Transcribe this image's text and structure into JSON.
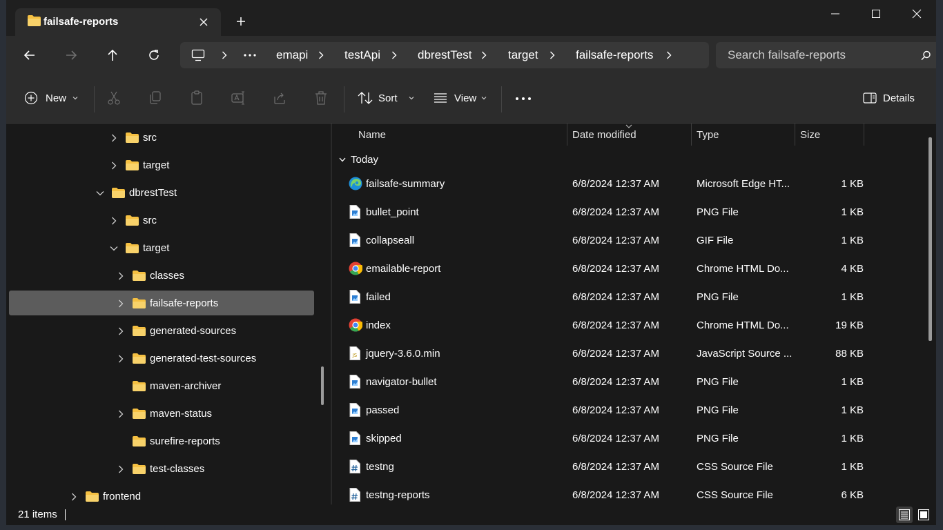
{
  "window": {
    "tab_title": "failsafe-reports"
  },
  "address": {
    "crumbs": [
      "emapi",
      "testApi",
      "dbrestTest",
      "target",
      "failsafe-reports"
    ]
  },
  "search": {
    "placeholder": "Search failsafe-reports"
  },
  "commands": {
    "new_label": "New",
    "sort_label": "Sort",
    "view_label": "View",
    "details_label": "Details"
  },
  "tree": [
    {
      "label": "src",
      "chevron": "right"
    },
    {
      "label": "target",
      "chevron": "right"
    },
    {
      "label": "dbrestTest",
      "chevron": "down"
    },
    {
      "label": "src",
      "chevron": "right"
    },
    {
      "label": "target",
      "chevron": "down"
    },
    {
      "label": "classes",
      "chevron": "right"
    },
    {
      "label": "failsafe-reports",
      "chevron": "right",
      "selected": true
    },
    {
      "label": "generated-sources",
      "chevron": "right"
    },
    {
      "label": "generated-test-sources",
      "chevron": "right"
    },
    {
      "label": "maven-archiver",
      "chevron": "none"
    },
    {
      "label": "maven-status",
      "chevron": "right"
    },
    {
      "label": "surefire-reports",
      "chevron": "none"
    },
    {
      "label": "test-classes",
      "chevron": "right"
    },
    {
      "label": "frontend",
      "chevron": "right"
    }
  ],
  "columns": {
    "name": "Name",
    "date": "Date modified",
    "type": "Type",
    "size": "Size"
  },
  "group": {
    "label": "Today"
  },
  "files": [
    {
      "name": "failsafe-summary",
      "date": "6/8/2024 12:37 AM",
      "type": "Microsoft Edge HT...",
      "size": "1 KB",
      "icon": "edge-icon"
    },
    {
      "name": "bullet_point",
      "date": "6/8/2024 12:37 AM",
      "type": "PNG File",
      "size": "1 KB",
      "icon": "image-file-icon"
    },
    {
      "name": "collapseall",
      "date": "6/8/2024 12:37 AM",
      "type": "GIF File",
      "size": "1 KB",
      "icon": "image-file-icon"
    },
    {
      "name": "emailable-report",
      "date": "6/8/2024 12:37 AM",
      "type": "Chrome HTML Do...",
      "size": "4 KB",
      "icon": "chrome-icon"
    },
    {
      "name": "failed",
      "date": "6/8/2024 12:37 AM",
      "type": "PNG File",
      "size": "1 KB",
      "icon": "image-file-icon"
    },
    {
      "name": "index",
      "date": "6/8/2024 12:37 AM",
      "type": "Chrome HTML Do...",
      "size": "19 KB",
      "icon": "chrome-icon"
    },
    {
      "name": "jquery-3.6.0.min",
      "date": "6/8/2024 12:37 AM",
      "type": "JavaScript Source ...",
      "size": "88 KB",
      "icon": "js-file-icon"
    },
    {
      "name": "navigator-bullet",
      "date": "6/8/2024 12:37 AM",
      "type": "PNG File",
      "size": "1 KB",
      "icon": "image-file-icon"
    },
    {
      "name": "passed",
      "date": "6/8/2024 12:37 AM",
      "type": "PNG File",
      "size": "1 KB",
      "icon": "image-file-icon"
    },
    {
      "name": "skipped",
      "date": "6/8/2024 12:37 AM",
      "type": "PNG File",
      "size": "1 KB",
      "icon": "image-file-icon"
    },
    {
      "name": "testng",
      "date": "6/8/2024 12:37 AM",
      "type": "CSS Source File",
      "size": "1 KB",
      "icon": "css-file-icon"
    },
    {
      "name": "testng-reports",
      "date": "6/8/2024 12:37 AM",
      "type": "CSS Source File",
      "size": "6 KB",
      "icon": "css-file-icon"
    }
  ],
  "status": {
    "item_count": "21 items"
  },
  "colors": {
    "folder": "#f5c042",
    "selection": "#5c5c5c",
    "window_bg": "#191919",
    "bar_bg": "#2c2c2c"
  }
}
